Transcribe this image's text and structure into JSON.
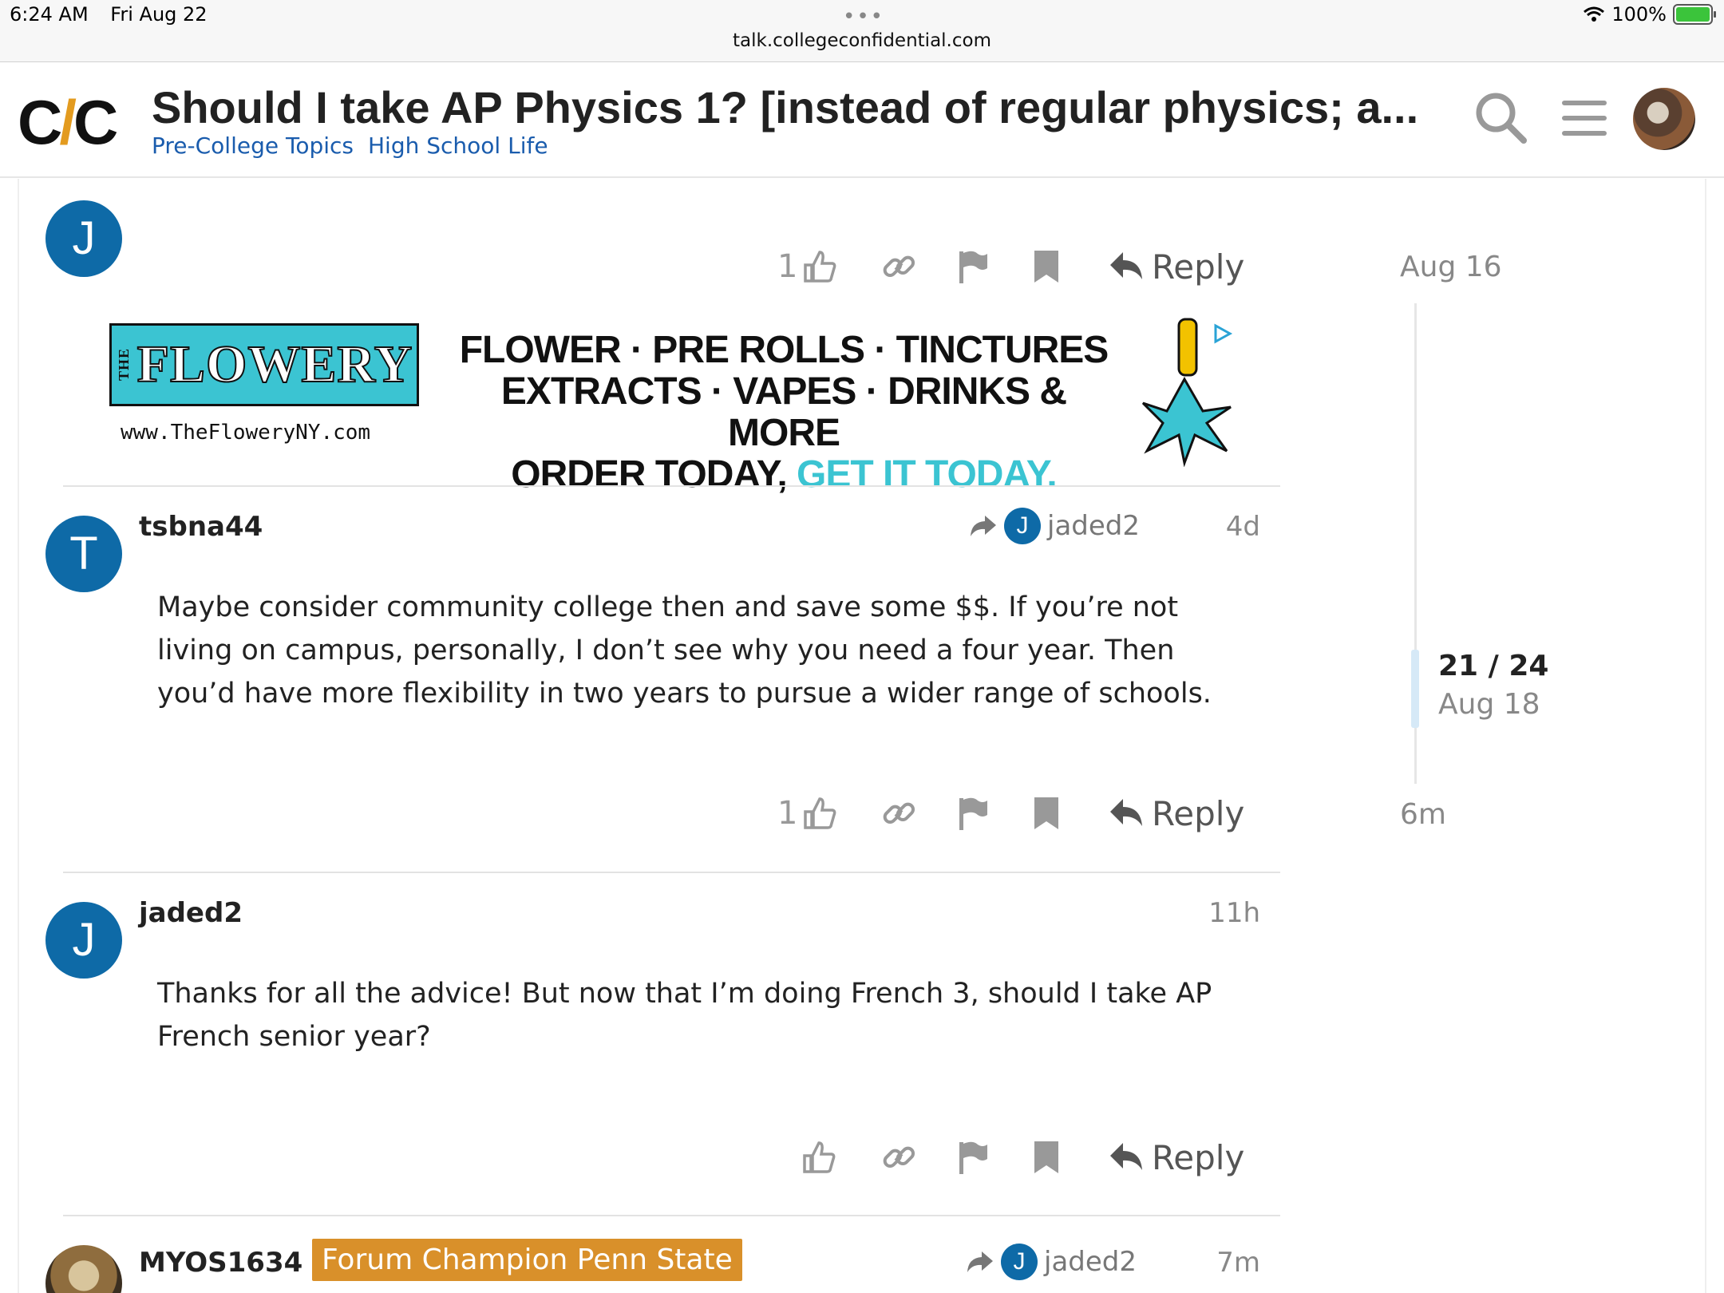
{
  "status_bar": {
    "time": "6:24 AM",
    "date": "Fri Aug 22",
    "dots": "•••",
    "url": "talk.collegeconfidential.com",
    "battery": "100%"
  },
  "header": {
    "logo_c1": "C",
    "logo_slash": "/",
    "logo_c2": "C",
    "title": "Should I take AP Physics 1? [instead of regular physics; a...",
    "categories": [
      "Pre-College Topics",
      "High School Life"
    ]
  },
  "actions": {
    "reply_label": "Reply"
  },
  "top_post": {
    "avatar_letter": "J",
    "like_count": "1"
  },
  "ad": {
    "logo_small": "THE",
    "logo_text": "FLOWERY",
    "url": "www.TheFloweryNY.com",
    "line1": "FLOWER · PRE ROLLS · TINCTURES",
    "line2": "EXTRACTS · VAPES · DRINKS & MORE",
    "line3a": "ORDER TODAY,",
    "line3b": "GET IT TODAY."
  },
  "posts": [
    {
      "avatar_letter": "T",
      "username": "tsbna44",
      "reply_to_letter": "J",
      "reply_to": "jaded2",
      "age": "4d",
      "body": "Maybe consider community college then and save some $$. If you’re not living on campus, personally, I don’t see why you need a four year. Then you’d have more flexibility in two years to pursue a wider range of schools.",
      "like_count": "1"
    },
    {
      "avatar_letter": "J",
      "username": "jaded2",
      "age": "11h",
      "body": "Thanks for all the advice! But now that I’m doing French 3, should I take AP French senior year?"
    },
    {
      "username": "MYOS1634",
      "flair": "Forum Champion Penn State",
      "reply_to_letter": "J",
      "reply_to": "jaded2",
      "age": "7m"
    }
  ],
  "timeline": {
    "top_date": "Aug 16",
    "position": "21 / 24",
    "position_date": "Aug 18",
    "bottom": "6m"
  },
  "colors": {
    "accent_blue": "#0e6aa7",
    "category_link": "#1a5cad",
    "flair": "#d9902a",
    "ad_teal": "#3bc4d2",
    "logo_orange": "#e39b1f"
  }
}
